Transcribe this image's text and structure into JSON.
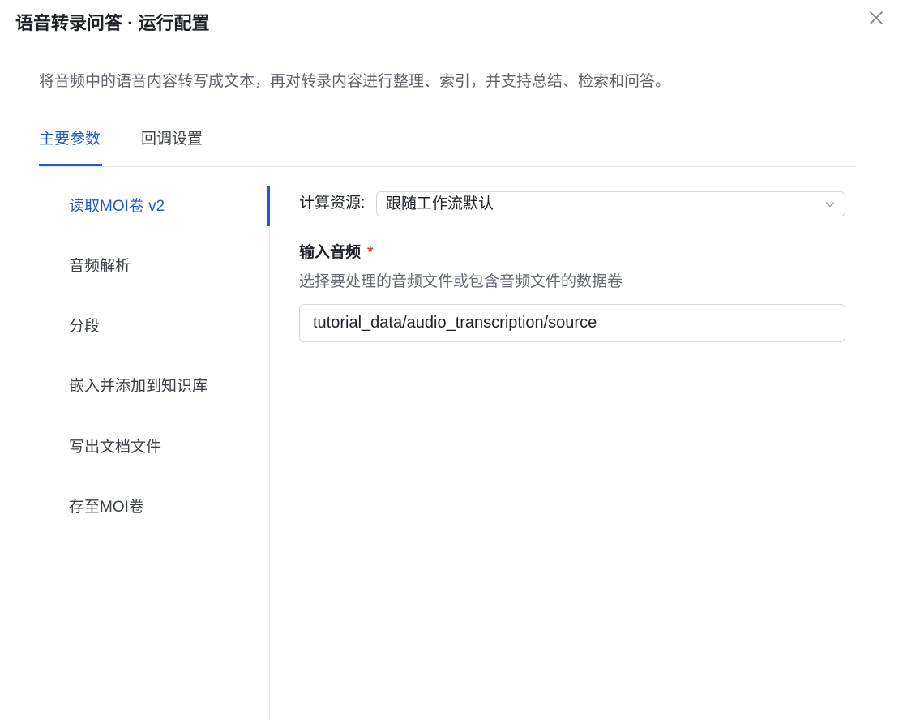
{
  "dialog": {
    "title": "语音转录问答 · 运行配置",
    "description": "将音频中的语音内容转写成文本，再对转录内容进行整理、索引，并支持总结、检索和问答。"
  },
  "tabs": [
    {
      "label": "主要参数",
      "active": true
    },
    {
      "label": "回调设置",
      "active": false
    }
  ],
  "steps": [
    {
      "label": "读取MOI卷 v2",
      "active": true
    },
    {
      "label": "音频解析",
      "active": false
    },
    {
      "label": "分段",
      "active": false
    },
    {
      "label": "嵌入并添加到知识库",
      "active": false
    },
    {
      "label": "写出文档文件",
      "active": false
    },
    {
      "label": "存至MOI卷",
      "active": false
    }
  ],
  "form": {
    "compute_label": "计算资源:",
    "compute_value": "跟随工作流默认",
    "input_audio_label": "输入音频",
    "required_mark": "*",
    "input_audio_hint": "选择要处理的音频文件或包含音频文件的数据卷",
    "input_audio_value": "tutorial_data/audio_transcription/source"
  },
  "icons": {
    "close": "close-icon",
    "select_arrow": "chevron-down-icon"
  },
  "colors": {
    "accent": "#1f5ad1",
    "required": "#e23b36",
    "divider": "#e5e6eb",
    "text": "#1f2329",
    "muted_text": "#646a73"
  }
}
